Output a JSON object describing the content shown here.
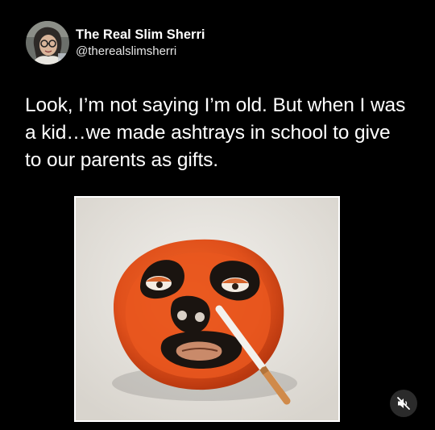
{
  "author": {
    "display_name": "The Real Slim Sherri",
    "handle": "@therealslimsherri",
    "avatar_icon": "profile-avatar"
  },
  "post": {
    "text": "Look, I’m not saying I’m old. But when I was a kid…we made ashtrays in school to give to our parents as gifts."
  },
  "media": {
    "type": "photo",
    "mute_icon": "speaker-muted-icon"
  },
  "colors": {
    "background": "#000000",
    "text": "#ffffff",
    "ashtray_orange": "#e8561c"
  }
}
